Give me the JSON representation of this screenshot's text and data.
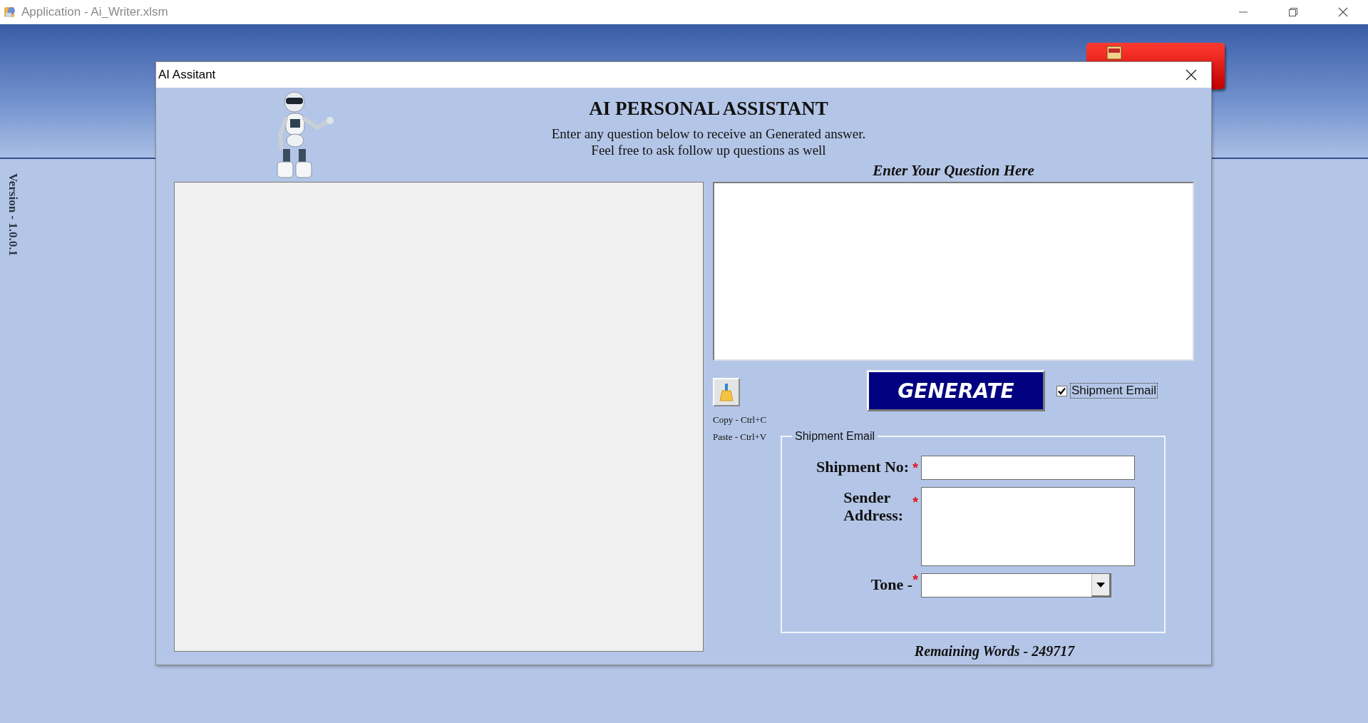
{
  "app_window": {
    "title": "Application - Ai_Writer.xlsm"
  },
  "sidebar": {
    "version": "Version - 1.0.0.1"
  },
  "dialog": {
    "title": "AI Assitant",
    "heading": "AI PERSONAL ASSISTANT",
    "subtitle_lines": [
      "Enter any question below to receive an Generated answer.",
      "Feel free to ask follow up questions as well"
    ],
    "question_label": "Enter Your Question Here",
    "shortcuts": [
      "Copy - Ctrl+C",
      "Paste - Ctrl+V"
    ],
    "generate_button": "GENERATE",
    "email_toggle": {
      "label": "Shipment Email",
      "checked": true
    },
    "shipment_email": {
      "title": "Shipment Email",
      "fields": [
        {
          "kind": "text",
          "label": "Shipment No:",
          "required_mark": "*"
        },
        {
          "kind": "textarea",
          "label": "Sender Address:",
          "required_mark": "*"
        },
        {
          "kind": "dropdown",
          "label": "Tone -",
          "required_mark": "*"
        }
      ]
    },
    "remaining_words": "Remaining Words - 249717"
  }
}
